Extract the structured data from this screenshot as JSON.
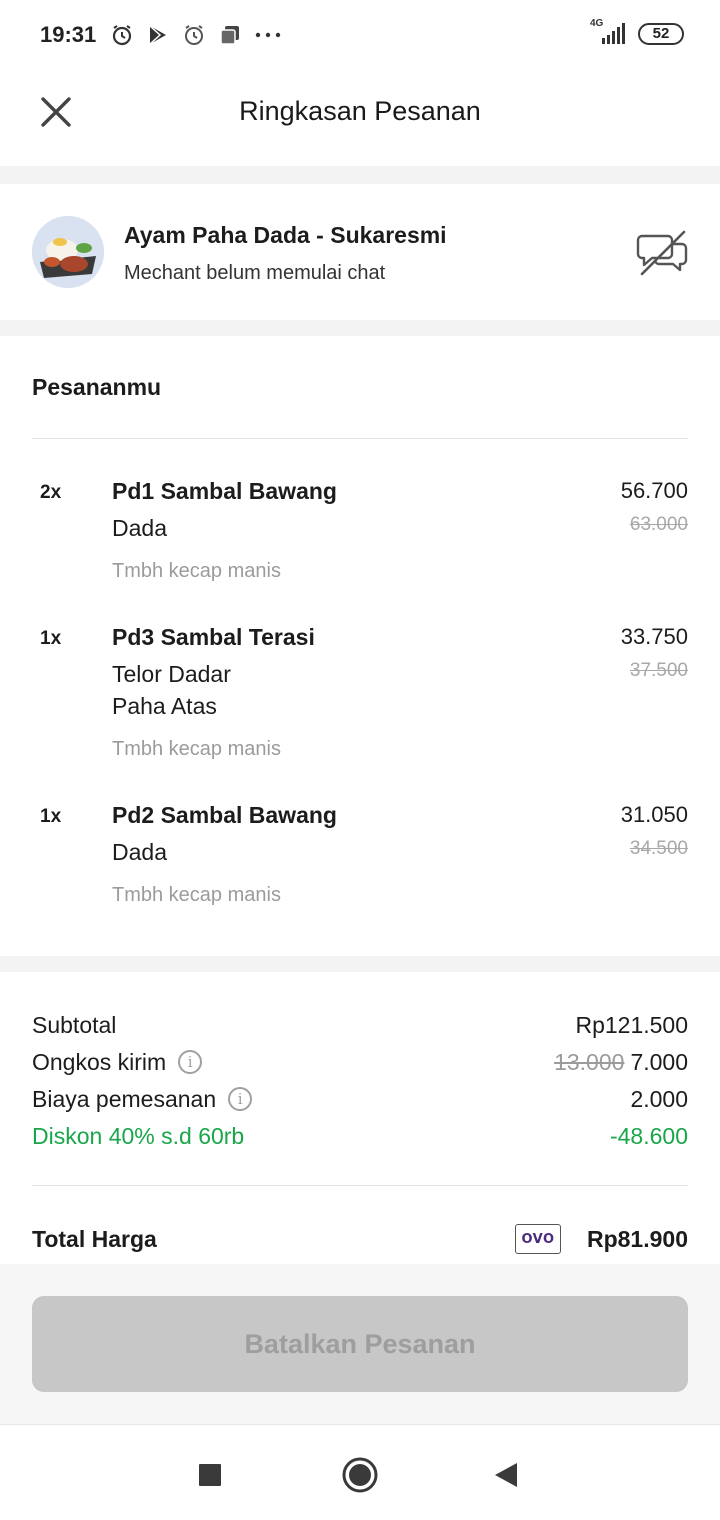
{
  "status_bar": {
    "time": "19:31",
    "network": "4G",
    "battery": "52"
  },
  "header": {
    "title": "Ringkasan Pesanan"
  },
  "merchant": {
    "name": "Ayam Paha Dada - Sukaresmi",
    "subtitle": "Mechant belum memulai chat"
  },
  "order": {
    "section_title": "Pesananmu",
    "items": [
      {
        "qty": "2x",
        "name": "Pd1 Sambal Bawang",
        "variants": [
          "Dada"
        ],
        "note": "Tmbh kecap manis",
        "price": "56.700",
        "original_price": "63.000"
      },
      {
        "qty": "1x",
        "name": "Pd3 Sambal Terasi",
        "variants": [
          "Telor Dadar",
          "Paha Atas"
        ],
        "note": "Tmbh kecap manis",
        "price": "33.750",
        "original_price": "37.500"
      },
      {
        "qty": "1x",
        "name": "Pd2 Sambal Bawang",
        "variants": [
          "Dada"
        ],
        "note": "Tmbh kecap manis",
        "price": "31.050",
        "original_price": "34.500"
      }
    ]
  },
  "summary": {
    "subtotal_label": "Subtotal",
    "subtotal_value": "Rp121.500",
    "shipping_label": "Ongkos kirim",
    "shipping_original": "13.000",
    "shipping_value": "7.000",
    "fee_label": "Biaya pemesanan",
    "fee_value": "2.000",
    "discount_label": "Diskon 40% s.d 60rb",
    "discount_value": "-48.600",
    "total_label": "Total Harga",
    "payment_method": "OVO",
    "total_value": "Rp81.900"
  },
  "actions": {
    "cancel_label": "Batalkan Pesanan"
  },
  "colors": {
    "discount_green": "#1aa64b",
    "disabled_button": "#c7c7c7"
  }
}
